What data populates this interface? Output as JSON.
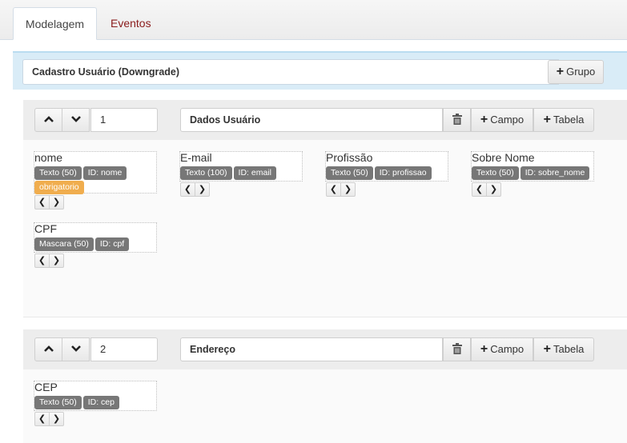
{
  "tabs": [
    {
      "label": "Modelagem",
      "active": true
    },
    {
      "label": "Eventos",
      "active": false
    }
  ],
  "form": {
    "title": "Cadastro Usuário (Downgrade)",
    "add_group_label": "Grupo"
  },
  "groups": [
    {
      "order": "1",
      "title": "Dados Usuário",
      "add_field_label": "Campo",
      "add_table_label": "Tabela",
      "fields": [
        {
          "name": "nome",
          "type": "Texto (50)",
          "id": "ID: nome",
          "required": "obrigatorio"
        },
        {
          "name": "E-mail",
          "type": "Texto (100)",
          "id": "ID: email"
        },
        {
          "name": "Profissão",
          "type": "Texto (50)",
          "id": "ID: profissao"
        },
        {
          "name": "Sobre Nome",
          "type": "Texto (50)",
          "id": "ID: sobre_nome"
        },
        {
          "name": "CPF",
          "type": "Mascara (50)",
          "id": "ID: cpf"
        }
      ]
    },
    {
      "order": "2",
      "title": "Endereço",
      "add_field_label": "Campo",
      "add_table_label": "Tabela",
      "fields": [
        {
          "name": "CEP",
          "type": "Texto (50)",
          "id": "ID: cep"
        }
      ]
    }
  ],
  "icons": {
    "up": "chevron-up-icon",
    "down": "chevron-down-icon",
    "trash": "trash-icon",
    "plus": "plus-icon",
    "left": "chevron-left-icon",
    "right": "chevron-right-icon"
  },
  "colors": {
    "link": "#8a1c1c",
    "badge": "#777777",
    "required_badge": "#f0ad4e",
    "form_header_bg": "#d9ecf7"
  }
}
